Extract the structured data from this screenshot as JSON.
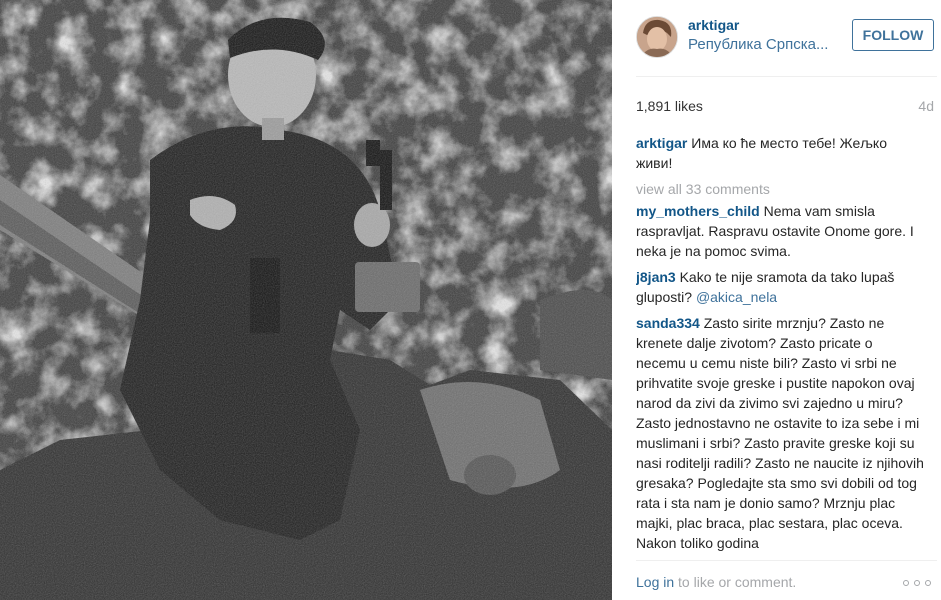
{
  "post": {
    "image_alt_icon": "black-white-photo",
    "author": "arktigar",
    "location": "Република Српска...",
    "follow_label": "FOLLOW",
    "likes": "1,891 likes",
    "time_ago": "4d"
  },
  "caption": {
    "user": "arktigar",
    "text": "Има ко ће место тебе! Жељко живи!"
  },
  "view_all_comments": "view all 33 comments",
  "comments": [
    {
      "user": "my_mothers_child",
      "text": "Nema vam smisla raspravljat. Raspravu ostavite Onome gore. I neka je na pomoc svima."
    },
    {
      "user": "j8jan3",
      "text": "Kako te nije sramota da tako lupaš gluposti?",
      "mention": "@akica_nela"
    },
    {
      "user": "sanda334",
      "text": "Zasto sirite mrznju? Zasto ne krenete dalje zivotom? Zasto pricate o necemu u cemu niste bili? Zasto vi srbi ne prihvatite svoje greske i pustite napokon ovaj narod da zivi da zivimo svi zajedno u miru? Zasto jednostavno ne ostavite to iza sebe i mi muslimani i srbi? Zasto pravite greske koji su nasi roditelji radili? Zasto ne naucite iz njihovih gresaka? Pogledajte sta smo svi dobili od tog rata i sta nam je donio samo? Mrznju plac majki, plac braca, plac sestara, plac oceva. Nakon toliko godina"
    }
  ],
  "footer": {
    "login_label": "Log in",
    "rest": " to like or comment."
  },
  "colors": {
    "link": "#125688",
    "accent": "#3f729b",
    "muted": "#a5a7aa"
  }
}
